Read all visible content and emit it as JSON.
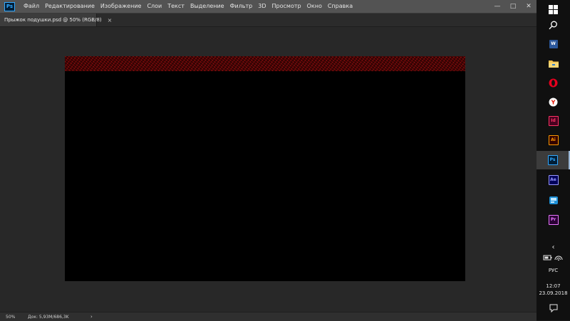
{
  "app": {
    "logo_text": "Ps",
    "menu": [
      "Файл",
      "Редактирование",
      "Изображение",
      "Слои",
      "Текст",
      "Выделение",
      "Фильтр",
      "3D",
      "Просмотр",
      "Окно",
      "Справка"
    ],
    "window_controls": {
      "minimize": "—",
      "maximize": "□",
      "close": "✕"
    }
  },
  "document_tab": {
    "label": "Прыжок подушки.psd @ 50% (RGB/8)",
    "close": "×"
  },
  "canvas": {
    "fill_color": "#000000",
    "strip_color": "#8b0a0a"
  },
  "statusbar": {
    "zoom": "50%",
    "doc_info": "Док: 5,93M/686,3K",
    "arrow": "›"
  },
  "taskbar": {
    "pinned_apps": [
      {
        "name": "word",
        "glyph": "W"
      },
      {
        "name": "explorer",
        "glyph": ""
      },
      {
        "name": "opera",
        "glyph": "O"
      },
      {
        "name": "yandex",
        "glyph": "Y"
      },
      {
        "name": "indesign",
        "glyph": "Id"
      },
      {
        "name": "illustrator",
        "glyph": "Ai"
      },
      {
        "name": "photoshop",
        "glyph": "Ps"
      },
      {
        "name": "after-effects",
        "glyph": "Ae"
      },
      {
        "name": "app-blue",
        "glyph": ""
      },
      {
        "name": "premiere",
        "glyph": "Pr"
      }
    ],
    "tray": {
      "show_hidden": "‹",
      "language": "РУС",
      "time": "12:07",
      "date": "23.09.2018"
    }
  },
  "colors": {
    "menubar": "#535353",
    "workspace": "#282828",
    "taskbar": "#101010",
    "accent": "#31a8ff"
  }
}
